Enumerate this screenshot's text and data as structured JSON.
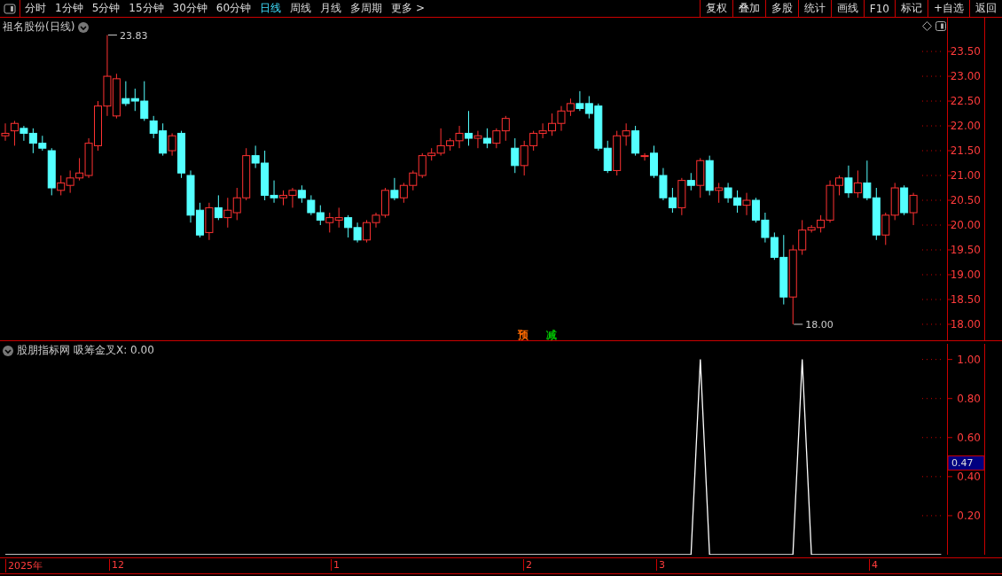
{
  "toolbar": {
    "periods": [
      {
        "label": "分时",
        "selected": false
      },
      {
        "label": "1分钟",
        "selected": false
      },
      {
        "label": "5分钟",
        "selected": false
      },
      {
        "label": "15分钟",
        "selected": false
      },
      {
        "label": "30分钟",
        "selected": false
      },
      {
        "label": "60分钟",
        "selected": false
      },
      {
        "label": "日线",
        "selected": true
      },
      {
        "label": "周线",
        "selected": false
      },
      {
        "label": "月线",
        "selected": false
      },
      {
        "label": "多周期",
        "selected": false
      }
    ],
    "more": "更多 >",
    "actions": [
      "复权",
      "叠加",
      "多股",
      "统计",
      "画线",
      "F10",
      "标记",
      "+自选",
      "返回"
    ]
  },
  "price_panel": {
    "title": "祖名股份(日线)",
    "high_label": "23.83",
    "low_label": "18.00",
    "chart_data": {
      "type": "candlestick",
      "ylim": [
        17.66,
        24.18
      ],
      "yticks": [
        {
          "value": 23.5,
          "label": "23.50"
        },
        {
          "value": 23,
          "label": "23.00"
        },
        {
          "value": 22.5,
          "label": "22.50"
        },
        {
          "value": 22,
          "label": "22.00"
        },
        {
          "value": 21.5,
          "label": "21.50"
        },
        {
          "value": 21,
          "label": "21.00"
        },
        {
          "value": 20.5,
          "label": "20.50"
        },
        {
          "value": 20,
          "label": "20.00"
        },
        {
          "value": 19.5,
          "label": "19.50"
        },
        {
          "value": 19,
          "label": "19.00"
        },
        {
          "value": 18.5,
          "label": "18.50"
        },
        {
          "value": 18,
          "label": "18.00"
        }
      ],
      "ohlc": [
        [
          21.8,
          22.05,
          21.7,
          21.85
        ],
        [
          21.9,
          22.1,
          21.6,
          22.05
        ],
        [
          21.95,
          22.0,
          21.7,
          21.85
        ],
        [
          21.85,
          21.95,
          21.45,
          21.65
        ],
        [
          21.65,
          21.8,
          21.5,
          21.55
        ],
        [
          21.5,
          21.55,
          20.6,
          20.75
        ],
        [
          20.7,
          21.0,
          20.6,
          20.85
        ],
        [
          20.8,
          21.1,
          20.65,
          20.95
        ],
        [
          20.95,
          21.35,
          20.9,
          21.05
        ],
        [
          21.0,
          21.75,
          20.95,
          21.65
        ],
        [
          21.6,
          22.5,
          21.5,
          22.4
        ],
        [
          22.4,
          23.83,
          22.2,
          23.0
        ],
        [
          22.2,
          23.05,
          22.15,
          22.95
        ],
        [
          22.55,
          22.9,
          22.4,
          22.45
        ],
        [
          22.55,
          22.75,
          22.3,
          22.5
        ],
        [
          22.5,
          22.9,
          22.1,
          22.15
        ],
        [
          22.1,
          22.2,
          21.75,
          21.85
        ],
        [
          21.9,
          22.05,
          21.4,
          21.45
        ],
        [
          21.5,
          21.85,
          21.4,
          21.8
        ],
        [
          21.85,
          21.9,
          20.95,
          21.05
        ],
        [
          21.0,
          21.1,
          20.05,
          20.2
        ],
        [
          20.3,
          20.45,
          19.75,
          19.8
        ],
        [
          19.85,
          20.45,
          19.7,
          20.35
        ],
        [
          20.35,
          20.6,
          20.1,
          20.15
        ],
        [
          20.15,
          20.55,
          19.95,
          20.3
        ],
        [
          20.25,
          20.75,
          20.1,
          20.55
        ],
        [
          20.55,
          21.55,
          20.5,
          21.4
        ],
        [
          21.4,
          21.6,
          21.15,
          21.25
        ],
        [
          21.25,
          21.5,
          20.5,
          20.6
        ],
        [
          20.6,
          20.9,
          20.45,
          20.55
        ],
        [
          20.55,
          20.7,
          20.4,
          20.6
        ],
        [
          20.6,
          20.75,
          20.35,
          20.7
        ],
        [
          20.7,
          20.8,
          20.45,
          20.55
        ],
        [
          20.5,
          20.6,
          20.2,
          20.25
        ],
        [
          20.25,
          20.4,
          20.0,
          20.1
        ],
        [
          20.05,
          20.25,
          19.85,
          20.15
        ],
        [
          20.1,
          20.35,
          19.95,
          20.15
        ],
        [
          20.15,
          20.2,
          19.75,
          19.95
        ],
        [
          19.95,
          20.05,
          19.65,
          19.7
        ],
        [
          19.7,
          20.1,
          19.65,
          20.05
        ],
        [
          20.05,
          20.25,
          19.95,
          20.2
        ],
        [
          20.2,
          20.75,
          20.15,
          20.7
        ],
        [
          20.7,
          20.95,
          20.5,
          20.55
        ],
        [
          20.55,
          20.85,
          20.45,
          20.8
        ],
        [
          20.8,
          21.1,
          20.7,
          21.05
        ],
        [
          21.0,
          21.45,
          20.95,
          21.4
        ],
        [
          21.4,
          21.55,
          21.3,
          21.45
        ],
        [
          21.45,
          21.95,
          21.4,
          21.6
        ],
        [
          21.6,
          21.75,
          21.5,
          21.7
        ],
        [
          21.7,
          22.0,
          21.55,
          21.85
        ],
        [
          21.85,
          22.3,
          21.6,
          21.75
        ],
        [
          21.75,
          21.9,
          21.55,
          21.8
        ],
        [
          21.75,
          21.95,
          21.55,
          21.65
        ],
        [
          21.65,
          21.95,
          21.55,
          21.9
        ],
        [
          21.9,
          22.2,
          21.7,
          22.15
        ],
        [
          21.55,
          21.75,
          21.05,
          21.2
        ],
        [
          21.2,
          21.7,
          21.0,
          21.6
        ],
        [
          21.6,
          21.9,
          21.5,
          21.85
        ],
        [
          21.85,
          22.05,
          21.75,
          21.9
        ],
        [
          21.9,
          22.25,
          21.8,
          22.05
        ],
        [
          22.05,
          22.4,
          21.9,
          22.3
        ],
        [
          22.3,
          22.55,
          22.2,
          22.45
        ],
        [
          22.45,
          22.7,
          22.3,
          22.35
        ],
        [
          22.45,
          22.6,
          22.15,
          22.25
        ],
        [
          22.4,
          22.45,
          21.5,
          21.55
        ],
        [
          21.55,
          21.7,
          21.05,
          21.1
        ],
        [
          21.1,
          21.9,
          21.0,
          21.8
        ],
        [
          21.8,
          22.05,
          21.6,
          21.9
        ],
        [
          21.9,
          22.0,
          21.4,
          21.45
        ],
        [
          21.4,
          21.45,
          21.3,
          21.4
        ],
        [
          21.45,
          21.6,
          20.95,
          21.0
        ],
        [
          21.0,
          21.15,
          20.5,
          20.55
        ],
        [
          20.55,
          20.75,
          20.25,
          20.35
        ],
        [
          20.35,
          20.95,
          20.2,
          20.9
        ],
        [
          20.9,
          21.05,
          20.7,
          20.8
        ],
        [
          20.8,
          21.35,
          20.55,
          21.3
        ],
        [
          21.3,
          21.4,
          20.6,
          20.7
        ],
        [
          20.7,
          20.85,
          20.45,
          20.75
        ],
        [
          20.75,
          20.85,
          20.45,
          20.55
        ],
        [
          20.55,
          20.7,
          20.25,
          20.4
        ],
        [
          20.4,
          20.65,
          20.2,
          20.5
        ],
        [
          20.5,
          20.55,
          20.05,
          20.1
        ],
        [
          20.1,
          20.25,
          19.65,
          19.75
        ],
        [
          19.75,
          19.85,
          19.3,
          19.35
        ],
        [
          19.35,
          19.8,
          18.4,
          18.55
        ],
        [
          18.55,
          19.6,
          18.0,
          19.5
        ],
        [
          19.5,
          20.1,
          19.4,
          19.9
        ],
        [
          19.9,
          20.0,
          19.85,
          19.95
        ],
        [
          19.95,
          20.2,
          19.85,
          20.1
        ],
        [
          20.1,
          20.9,
          20.05,
          20.8
        ],
        [
          20.8,
          21.0,
          20.6,
          20.95
        ],
        [
          20.95,
          21.2,
          20.55,
          20.65
        ],
        [
          20.65,
          21.1,
          20.55,
          20.85
        ],
        [
          20.85,
          21.3,
          20.5,
          20.55
        ],
        [
          20.55,
          20.75,
          19.7,
          19.8
        ],
        [
          19.8,
          20.25,
          19.6,
          20.2
        ],
        [
          20.2,
          20.85,
          20.1,
          20.75
        ],
        [
          20.75,
          20.8,
          20.2,
          20.25
        ],
        [
          20.25,
          20.65,
          20.0,
          20.6
        ]
      ]
    },
    "signals": [
      {
        "label": "预",
        "color": "#ff6a00"
      },
      {
        "label": "减",
        "color": "#00c000"
      }
    ]
  },
  "indicator_panel": {
    "title": "股朋指标网",
    "formula": "吸筹金叉X: 0.00",
    "cursor_value": "0.47",
    "chart_data": {
      "type": "line",
      "ylim": [
        0,
        1.08
      ],
      "yticks": [
        {
          "value": 0.2,
          "label": "0.20"
        },
        {
          "value": 0.4,
          "label": "0.40"
        },
        {
          "value": 0.6,
          "label": "0.60"
        },
        {
          "value": 0.8,
          "label": "0.80"
        },
        {
          "value": 1.0,
          "label": "1.00"
        }
      ],
      "series": [
        {
          "color": "#ffffff",
          "values": [
            0,
            0,
            0,
            0,
            0,
            0,
            0,
            0,
            0,
            0,
            0,
            0,
            0,
            0,
            0,
            0,
            0,
            0,
            0,
            0,
            0,
            0,
            0,
            0,
            0,
            0,
            0,
            0,
            0,
            0,
            0,
            0,
            0,
            0,
            0,
            0,
            0,
            0,
            0,
            0,
            0,
            0,
            0,
            0,
            0,
            0,
            0,
            0,
            0,
            0,
            0,
            0,
            0,
            0,
            0,
            0,
            0,
            0,
            0,
            0,
            0,
            0,
            0,
            0,
            0,
            0,
            0,
            0,
            0,
            0,
            0,
            0,
            0,
            0,
            0,
            1,
            0,
            0,
            0,
            0,
            0,
            0,
            0,
            0,
            0,
            0,
            1,
            0,
            0,
            0,
            0,
            0,
            0,
            0,
            0,
            0,
            0,
            0,
            0,
            0,
            0,
            0
          ]
        }
      ]
    }
  },
  "date_axis": [
    "2025年",
    "12",
    "1",
    "2",
    "3",
    "4"
  ]
}
